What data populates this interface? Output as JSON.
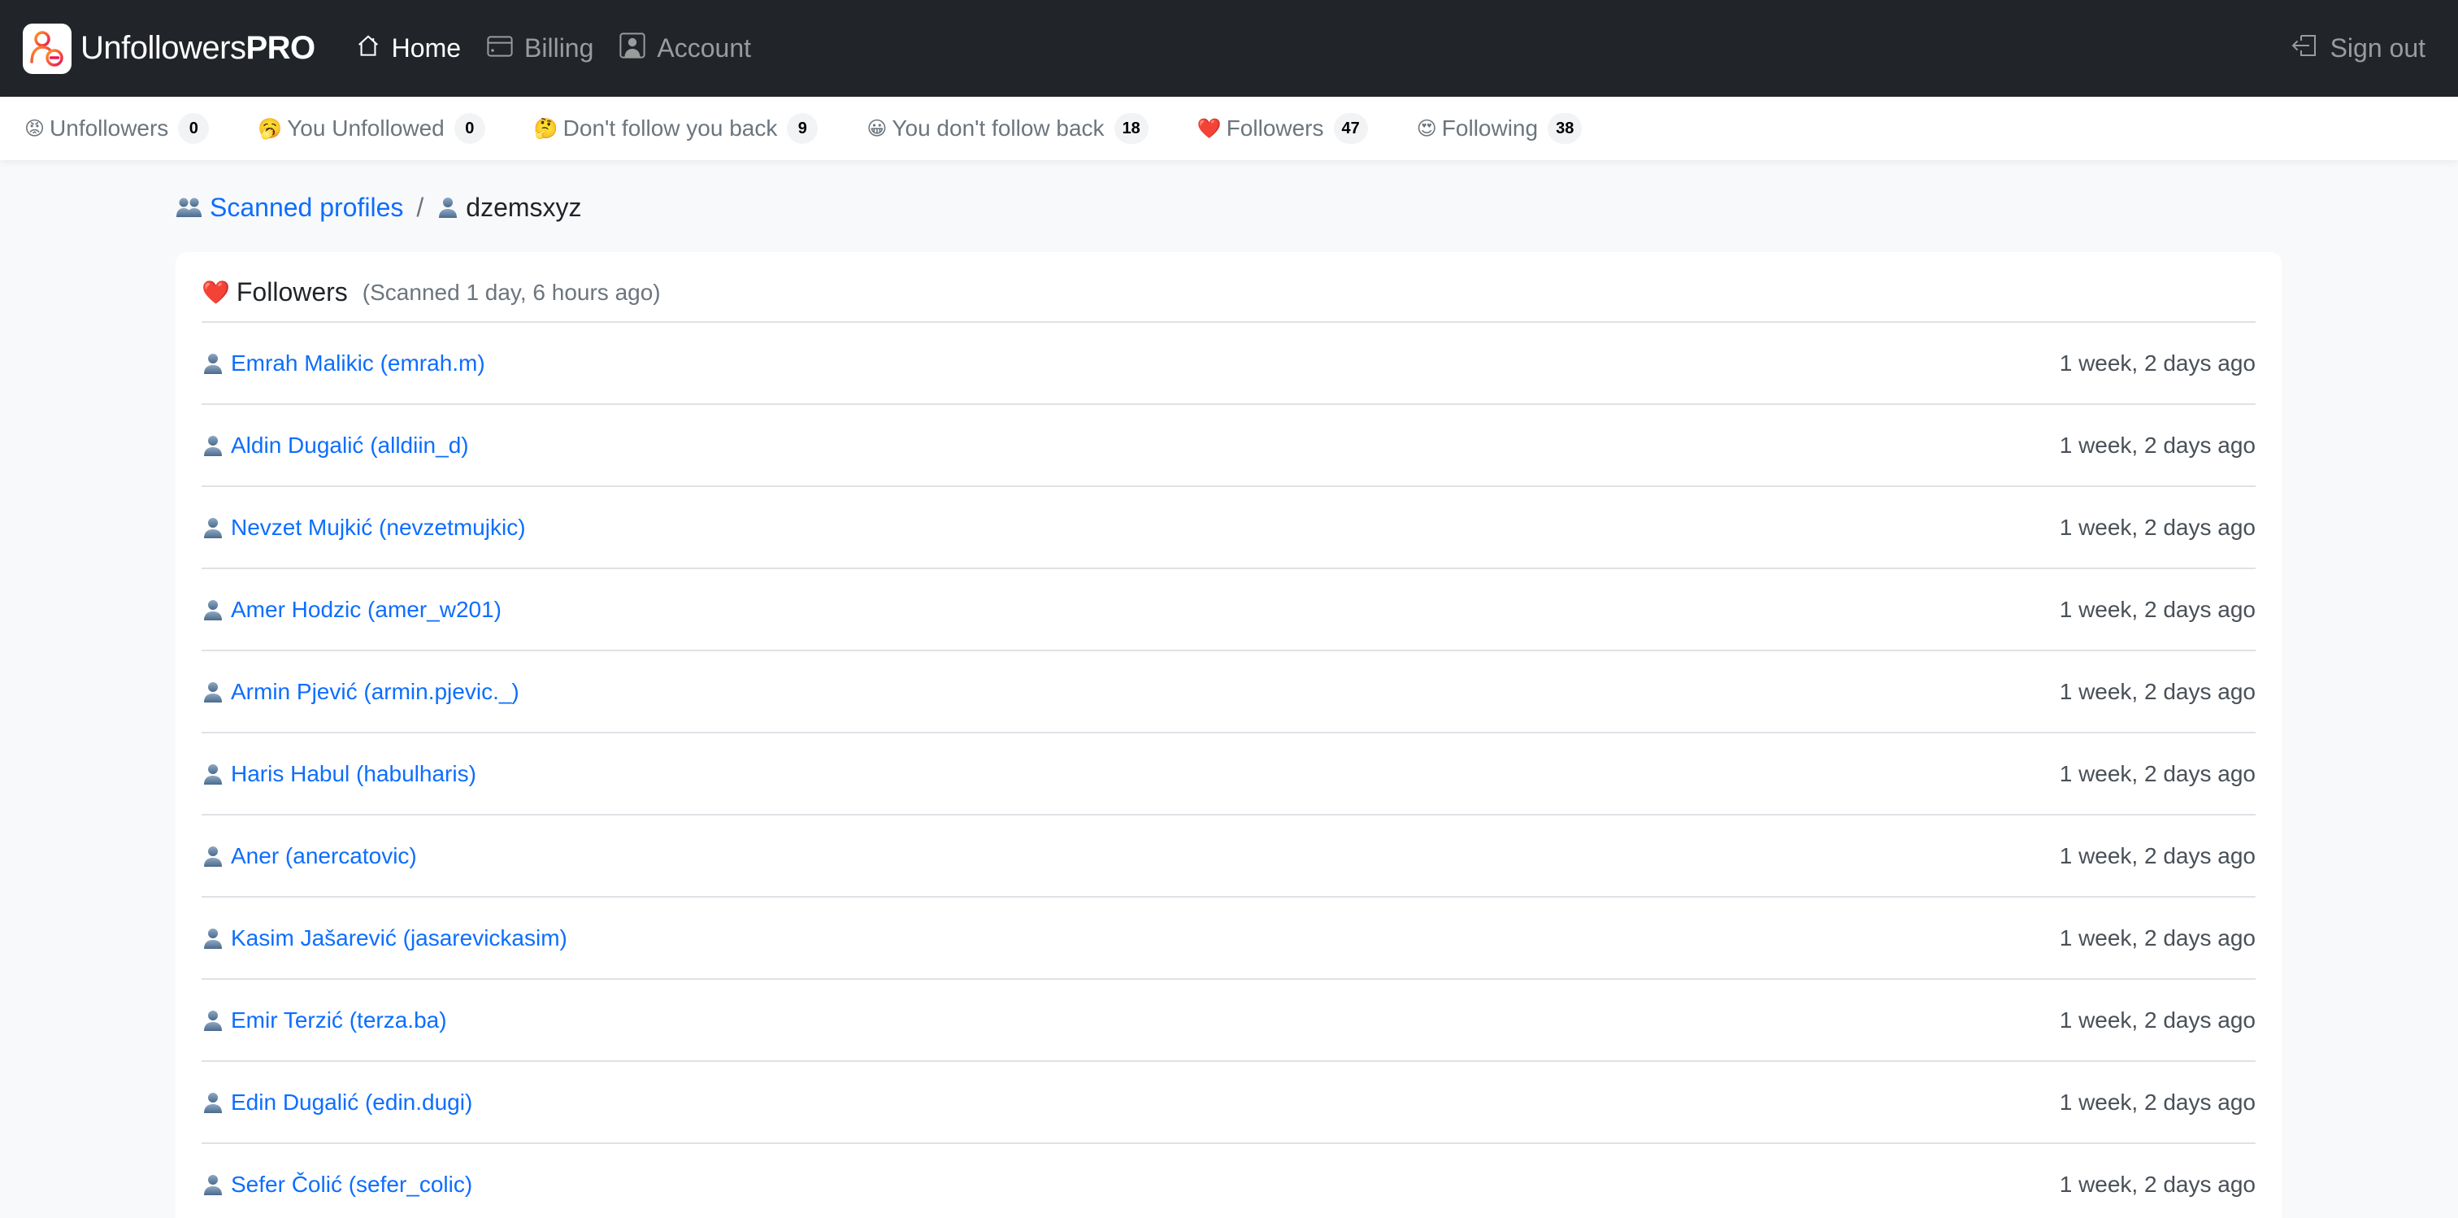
{
  "navbar": {
    "brand_regular": "Unfollowers",
    "brand_bold": "PRO",
    "links": [
      {
        "label": "Home",
        "icon": "house-icon",
        "active": true
      },
      {
        "label": "Billing",
        "icon": "credit-card-icon",
        "active": false
      },
      {
        "label": "Account",
        "icon": "person-square-icon",
        "active": false
      }
    ],
    "sign_out": {
      "label": "Sign out",
      "icon": "box-arrow-left-icon"
    }
  },
  "stats": [
    {
      "emoji": "😡",
      "label": "Unfollowers",
      "count": "0"
    },
    {
      "emoji": "🥱",
      "label": "You Unfollowed",
      "count": "0"
    },
    {
      "emoji": "🤔",
      "label": "Don't follow you back",
      "count": "9"
    },
    {
      "emoji": "😀",
      "label": "You don't follow back",
      "count": "18"
    },
    {
      "emoji": "❤️",
      "label": "Followers",
      "count": "47"
    },
    {
      "emoji": "😍",
      "label": "Following",
      "count": "38"
    }
  ],
  "breadcrumb": {
    "parent": {
      "label": "Scanned profiles",
      "icon": "people-icon"
    },
    "separator": "/",
    "current": {
      "label": "dzemsxyz",
      "icon": "person-icon"
    }
  },
  "card": {
    "title_emoji": "❤️",
    "title": "Followers",
    "subtitle": "(Scanned 1 day, 6 hours ago)",
    "rows": [
      {
        "name": "Emrah Malikic (emrah.m)",
        "time": "1 week, 2 days ago"
      },
      {
        "name": "Aldin Dugalić (alldiin_d)",
        "time": "1 week, 2 days ago"
      },
      {
        "name": "Nevzet Mujkić (nevzetmujkic)",
        "time": "1 week, 2 days ago"
      },
      {
        "name": "Amer Hodzic (amer_w201)",
        "time": "1 week, 2 days ago"
      },
      {
        "name": "Armin Pjević (armin.pjevic._)",
        "time": "1 week, 2 days ago"
      },
      {
        "name": "Haris Habul (habulharis)",
        "time": "1 week, 2 days ago"
      },
      {
        "name": "Aner (anercatovic)",
        "time": "1 week, 2 days ago"
      },
      {
        "name": "Kasim Jašarević (jasarevickasim)",
        "time": "1 week, 2 days ago"
      },
      {
        "name": "Emir Terzić (terza.ba)",
        "time": "1 week, 2 days ago"
      },
      {
        "name": "Edin Dugalić (edin.dugi)",
        "time": "1 week, 2 days ago"
      },
      {
        "name": "Sefer Čolić (sefer_colic)",
        "time": "1 week, 2 days ago"
      }
    ]
  },
  "colors": {
    "navbar_bg": "#212529",
    "link": "#0d6efd",
    "muted": "#6c757d",
    "page_bg": "#f8f9fa"
  }
}
